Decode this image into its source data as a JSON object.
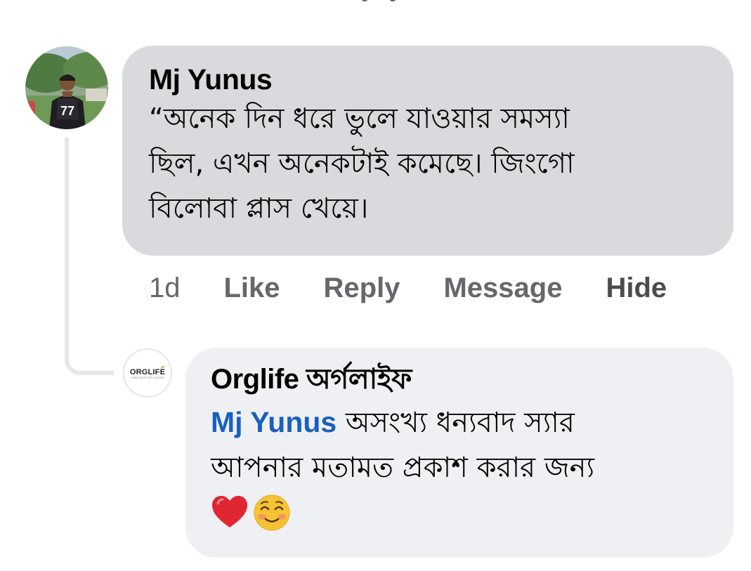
{
  "thread": {
    "comment": {
      "author": "Mj Yunus",
      "text": "“অনেক দিন ধরে ভুলে যাওয়ার সমস্যা\nছিল, এখন অনেকটাই কমেছে। জিংগো\nবিলোবা প্লাস খেয়ে।",
      "actions": {
        "time": "1d",
        "like": "Like",
        "reply": "Reply",
        "message": "Message",
        "hide": "Hide"
      }
    },
    "reply": {
      "author": "Orglife অর্গলাইফ",
      "mention": "Mj Yunus",
      "text": " অসংখ্য ধন্যবাদ স্যার\nআপনার মতামত প্রকাশ করার জন্য",
      "emojis": [
        "heart-icon",
        "smiling-face-icon"
      ],
      "logo": {
        "text": "ORGLIFE",
        "subtext": "YOUR HEALTH OUR CONCERN"
      }
    }
  },
  "colors": {
    "comment_bubble": "#d9dadd",
    "reply_bubble": "#eff0f3",
    "mention": "#1a5fbf",
    "secondary_text": "#65676b",
    "thread_line": "#e4e6eb"
  }
}
